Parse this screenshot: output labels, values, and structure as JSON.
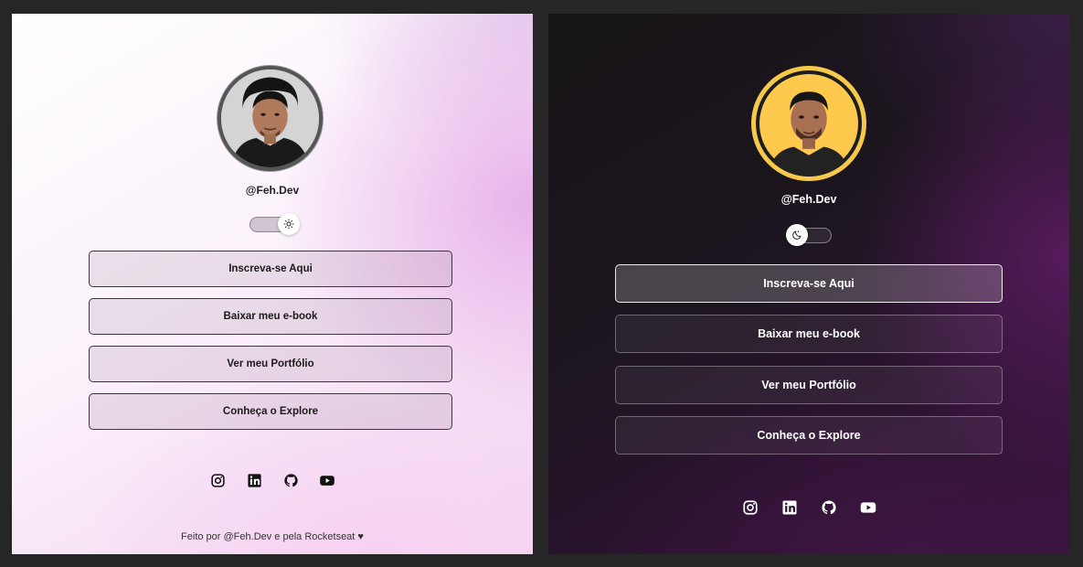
{
  "light": {
    "handle": "@Feh.Dev",
    "theme": "light",
    "buttons": [
      "Inscreva-se Aqui",
      "Baixar meu e-book",
      "Ver meu Portfólio",
      "Conheça o Explore"
    ],
    "footer": "Feito por @Feh.Dev e pela Rocketseat ♥"
  },
  "dark": {
    "handle": "@Feh.Dev",
    "theme": "dark",
    "buttons": [
      "Inscreva-se Aqui",
      "Baixar meu e-book",
      "Ver meu Portfólio",
      "Conheça o Explore"
    ],
    "active_button": "Inscreva-se Aqui"
  },
  "social_icons": [
    "instagram-icon",
    "linkedin-icon",
    "github-icon",
    "youtube-icon"
  ],
  "colors": {
    "light_accent": "#e8b2ea",
    "dark_accent": "#561a5c",
    "avatar_ring_dark": "#f6c94a"
  }
}
